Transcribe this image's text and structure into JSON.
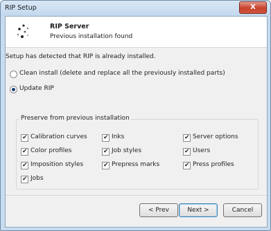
{
  "window": {
    "title": "RIP Setup",
    "close_label": "X"
  },
  "header": {
    "title": "RIP Server",
    "subtitle": "Previous installation found"
  },
  "intro": "Setup has detected that RIP is already installed.",
  "options": [
    {
      "label": "Clean install (delete and replace all the previously installed parts)",
      "selected": false
    },
    {
      "label": "Update RIP",
      "selected": true
    }
  ],
  "preserve": {
    "label": "Preserve from previous installation",
    "items": [
      {
        "label": "Calibration curves",
        "checked": true
      },
      {
        "label": "Inks",
        "checked": true
      },
      {
        "label": "Server options",
        "checked": true
      },
      {
        "label": "Color profiles",
        "checked": true
      },
      {
        "label": "Job styles",
        "checked": true
      },
      {
        "label": "Users",
        "checked": true
      },
      {
        "label": "Imposition styles",
        "checked": true
      },
      {
        "label": "Prepress marks",
        "checked": true
      },
      {
        "label": "Press profiles",
        "checked": true
      },
      {
        "label": "Jobs",
        "checked": true
      }
    ]
  },
  "buttons": {
    "prev": "< Prev",
    "next": "Next >",
    "cancel": "Cancel"
  },
  "colors": {
    "accent": "#1d3f73",
    "close": "#c7402c"
  }
}
